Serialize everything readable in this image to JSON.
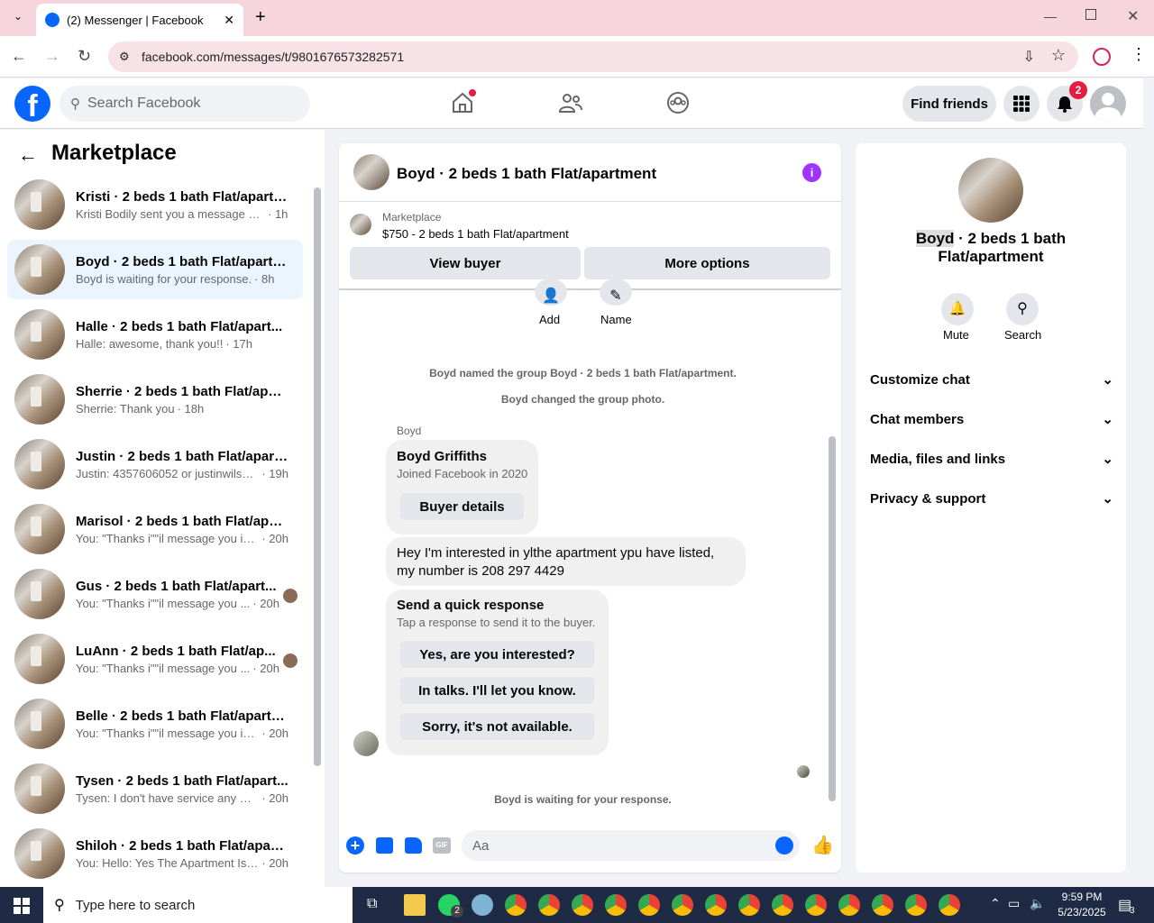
{
  "browser": {
    "tab_title": "(2) Messenger | Facebook",
    "url": "facebook.com/messages/t/9801676573282571"
  },
  "header": {
    "search_placeholder": "Search Facebook",
    "find_friends": "Find friends",
    "notification_count": "2"
  },
  "sidebar": {
    "title": "Marketplace",
    "conversations": [
      {
        "title": "Kristi · 2 beds 1 bath Flat/apartm...",
        "message": "Kristi Bodily sent you a message ab...",
        "time": "· 1h"
      },
      {
        "title": "Boyd · 2 beds 1 bath Flat/apartm...",
        "message": "Boyd is waiting for your response.",
        "time": "· 8h"
      },
      {
        "title": "Halle · 2 beds 1 bath Flat/apart...",
        "message": "Halle: awesome, thank you!!",
        "time": "· 17h"
      },
      {
        "title": "Sherrie · 2 beds 1 bath Flat/apart...",
        "message": "Sherrie: Thank you",
        "time": "· 18h"
      },
      {
        "title": "Justin · 2 beds 1 bath Flat/apart...",
        "message": "Justin: 4357606052 or justinwilson...",
        "time": "· 19h"
      },
      {
        "title": "Marisol · 2 beds 1 bath Flat/apar...",
        "message": "You: \"Thanks i\"\"il message you in ...",
        "time": "· 20h"
      },
      {
        "title": "Gus · 2 beds 1 bath Flat/apart...",
        "message": "You: \"Thanks i\"\"il message you ...",
        "time": "· 20h"
      },
      {
        "title": "LuAnn · 2 beds 1 bath Flat/ap...",
        "message": "You: \"Thanks i\"\"il message you ...",
        "time": "· 20h"
      },
      {
        "title": "Belle · 2 beds 1 bath Flat/apartm...",
        "message": "You: \"Thanks i\"\"il message you in ...",
        "time": "· 20h"
      },
      {
        "title": "Tysen · 2 beds 1 bath Flat/apart...",
        "message": "Tysen: I don't have service any wa...",
        "time": "· 20h"
      },
      {
        "title": "Shiloh · 2 beds 1 bath Flat/apart...",
        "message": "You: Hello: Yes The Apartment Is S...",
        "time": "· 20h"
      }
    ]
  },
  "chat": {
    "title": "Boyd · 2 beds 1 bath Flat/apartment",
    "listing_label": "Marketplace",
    "listing_detail": "$750 - 2 beds 1 bath Flat/apartment",
    "view_buyer": "View buyer",
    "more_options": "More options",
    "add_label": "Add",
    "name_label": "Name",
    "system_1": "Boyd named the group Boyd · 2 beds 1 bath Flat/apartment.",
    "system_2": "Boyd changed the group photo.",
    "sender": "Boyd",
    "card_name": "Boyd Griffiths",
    "card_sub": "Joined Facebook in 2020",
    "buyer_details": "Buyer details",
    "message_line1": "Hey I'm interested in ylthe apartment ypu have listed,",
    "message_line2": "my number is 208 297 4429",
    "quick_title": "Send a quick response",
    "quick_sub": "Tap a response to send it to the buyer.",
    "quick_responses": [
      "Yes, are you interested?",
      "In talks. I'll let you know.",
      "Sorry, it's not available."
    ],
    "waiting": "Boyd is waiting for your response.",
    "input_placeholder": "Aa"
  },
  "info": {
    "name_part1": "Boyd",
    "name_part2": " · 2 beds 1 bath",
    "name_line2": "Flat/apartment",
    "mute": "Mute",
    "search": "Search",
    "sections": [
      "Customize chat",
      "Chat members",
      "Media, files and links",
      "Privacy & support"
    ]
  },
  "taskbar": {
    "search_placeholder": "Type here to search",
    "time": "9:59 PM",
    "date": "5/23/2025",
    "whatsapp_badge": "2",
    "notif_count": "3"
  },
  "colors": {
    "facebook_blue": "#0866ff",
    "selected_bg": "#ebf5ff",
    "badge_red": "#e41e3f",
    "info_purple": "#a033ff"
  }
}
